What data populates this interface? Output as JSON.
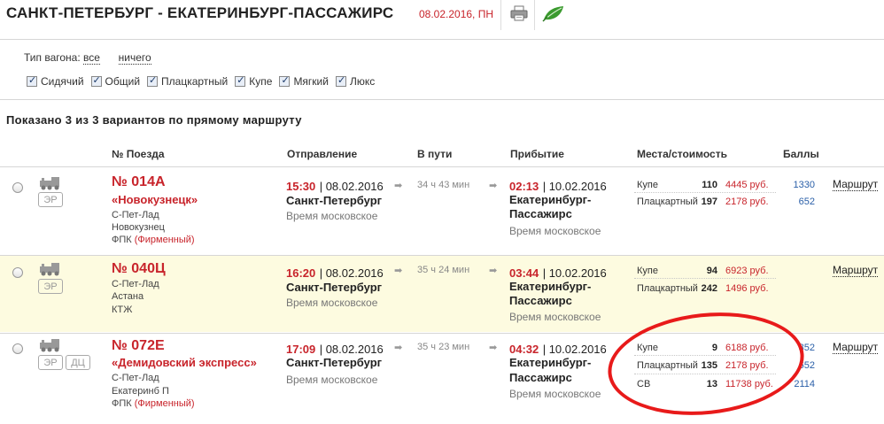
{
  "header": {
    "route": "САНКТ-ПЕТЕРБУРГ - ЕКАТЕРИНБУРГ-ПАССАЖИРС",
    "date": "08.02.2016, ПН"
  },
  "filter": {
    "label": "Тип вагона:",
    "all_link": "все",
    "none_link": "ничего",
    "types": [
      "Сидячий",
      "Общий",
      "Плацкартный",
      "Купе",
      "Мягкий",
      "Люкс"
    ]
  },
  "summary": "Показано 3 из 3 вариантов по прямому маршруту",
  "columns": {
    "train": "№ Поезда",
    "departure": "Отправление",
    "travel": "В пути",
    "arrival": "Прибытие",
    "seats": "Места/стоимость",
    "points": "Баллы"
  },
  "trains": [
    {
      "number": "№ 014А",
      "name": "«Новокузнецк»",
      "lines": [
        "С-Пет-Лад",
        "Новокузнец"
      ],
      "carrier": "ФПК",
      "carrier_note": "(Фирменный)",
      "badges": [
        "ЭР"
      ],
      "dep_time": "15:30",
      "dep_date": "| 08.02.2016",
      "dep_city": "Санкт-Петербург",
      "dep_tz": "Время московское",
      "duration": "34 ч 43 мин",
      "arr_time": "02:13",
      "arr_date": "| 10.02.2016",
      "arr_city_1": "Екатеринбург-",
      "arr_city_2": "Пассажирс",
      "arr_tz": "Время московское",
      "seats": [
        {
          "type": "Купе",
          "count": "110",
          "price": "4445 руб.",
          "points": "1330"
        },
        {
          "type": "Плацкартный",
          "count": "197",
          "price": "2178 руб.",
          "points": "652"
        }
      ],
      "route_link": "Маршрут"
    },
    {
      "number": "№ 040Ц",
      "name": "",
      "lines": [
        "С-Пет-Лад",
        "Астана",
        "КТЖ"
      ],
      "carrier": "",
      "carrier_note": "",
      "badges": [
        "ЭР"
      ],
      "dep_time": "16:20",
      "dep_date": "| 08.02.2016",
      "dep_city": "Санкт-Петербург",
      "dep_tz": "Время московское",
      "duration": "35 ч 24 мин",
      "arr_time": "03:44",
      "arr_date": "| 10.02.2016",
      "arr_city_1": "Екатеринбург-",
      "arr_city_2": "Пассажирс",
      "arr_tz": "Время московское",
      "seats": [
        {
          "type": "Купе",
          "count": "94",
          "price": "6923 руб.",
          "points": ""
        },
        {
          "type": "Плацкартный",
          "count": "242",
          "price": "1496 руб.",
          "points": ""
        }
      ],
      "route_link": "Маршрут"
    },
    {
      "number": "№ 072Е",
      "name": "«Демидовский экспресс»",
      "lines": [
        "С-Пет-Лад",
        "Екатеринб П"
      ],
      "carrier": "ФПК",
      "carrier_note": "(Фирменный)",
      "badges": [
        "ЭР",
        "ДЦ"
      ],
      "dep_time": "17:09",
      "dep_date": "| 08.02.2016",
      "dep_city": "Санкт-Петербург",
      "dep_tz": "Время московское",
      "duration": "35 ч 23 мин",
      "arr_time": "04:32",
      "arr_date": "| 10.02.2016",
      "arr_city_1": "Екатеринбург-",
      "arr_city_2": "Пассажирс",
      "arr_tz": "Время московское",
      "seats": [
        {
          "type": "Купе",
          "count": "9",
          "price": "6188 руб.",
          "points": "852"
        },
        {
          "type": "Плацкартный",
          "count": "135",
          "price": "2178 руб.",
          "points": "652"
        },
        {
          "type": "СВ",
          "count": "13",
          "price": "11738 руб.",
          "points": "2114"
        }
      ],
      "route_link": "Маршрут"
    }
  ],
  "colors": {
    "accent_red": "#c8242b",
    "link_blue": "#2a5fa8",
    "highlight_row": "#fdfbe0",
    "annotation_red": "#e81a1a"
  }
}
